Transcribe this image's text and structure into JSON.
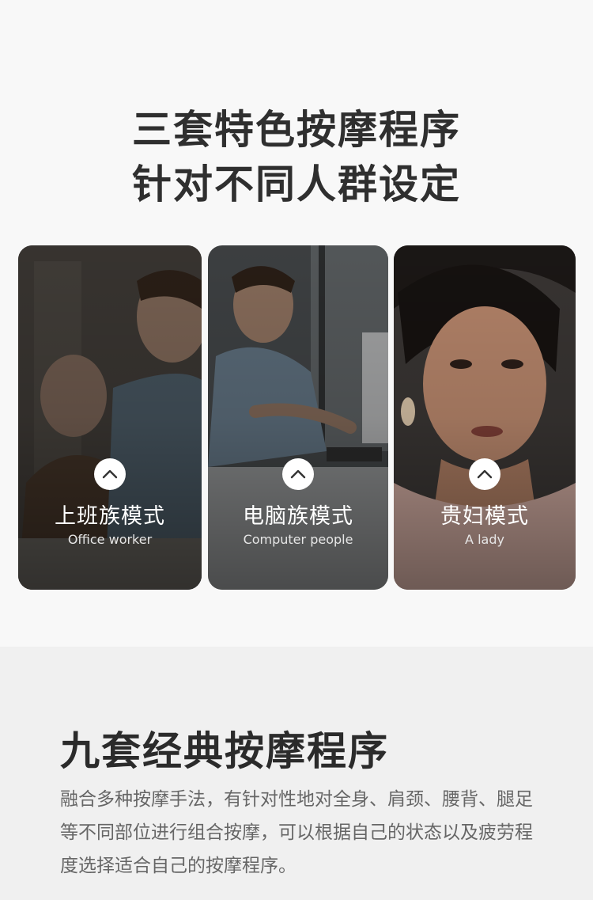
{
  "header": {
    "line1": "三套特色按摩程序",
    "line2": "针对不同人群设定"
  },
  "modes": [
    {
      "title": "上班族模式",
      "subtitle": "Office worker",
      "icon": "chevron-up-icon"
    },
    {
      "title": "电脑族模式",
      "subtitle": "Computer people",
      "icon": "chevron-up-icon"
    },
    {
      "title": "贵妇模式",
      "subtitle": "A lady",
      "icon": "chevron-up-icon"
    }
  ],
  "programs": {
    "title": "九套经典按摩程序",
    "description": "融合多种按摩手法，有针对性地对全身、肩颈、腰背、腿足等不同部位进行组合按摩，可以根据自己的状态以及疲劳程度选择适合自己的按摩程序。"
  },
  "colors": {
    "top_background": "#f8f8f8",
    "bottom_background": "#f0f0f0",
    "card_text": "#ffffff",
    "heading_text": "#2f2f2f",
    "body_text": "#666666"
  }
}
